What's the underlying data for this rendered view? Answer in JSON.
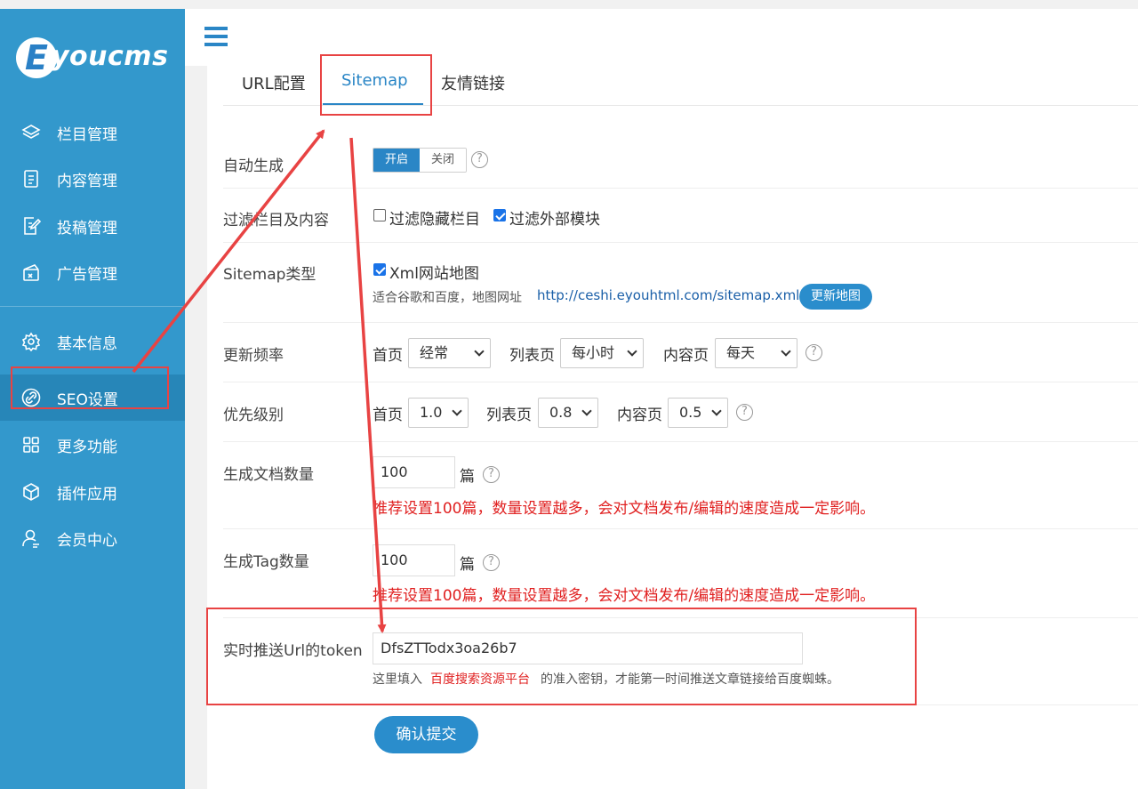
{
  "brand": {
    "logo_letter": "E",
    "logo_text": "youcms"
  },
  "sidebar": {
    "items": [
      {
        "label": "栏目管理",
        "icon": "layers-icon"
      },
      {
        "label": "内容管理",
        "icon": "document-icon"
      },
      {
        "label": "投稿管理",
        "icon": "edit-document-icon"
      },
      {
        "label": "广告管理",
        "icon": "ad-icon"
      },
      {
        "label": "基本信息",
        "icon": "gear-icon"
      },
      {
        "label": "SEO设置",
        "icon": "link-icon"
      },
      {
        "label": "更多功能",
        "icon": "grid-icon"
      },
      {
        "label": "插件应用",
        "icon": "cube-icon"
      },
      {
        "label": "会员中心",
        "icon": "user-icon"
      }
    ],
    "active_index": 5
  },
  "tabs": [
    {
      "label": "URL配置"
    },
    {
      "label": "Sitemap"
    },
    {
      "label": "友情链接"
    }
  ],
  "active_tab": 1,
  "form": {
    "auto_gen": {
      "label": "自动生成",
      "on": "开启",
      "off": "关闭"
    },
    "filter": {
      "label": "过滤栏目及内容",
      "opt1": "过滤隐藏栏目",
      "opt2": "过滤外部模块"
    },
    "sitemap_type": {
      "label": "Sitemap类型",
      "option": "Xml网站地图",
      "note": "适合谷歌和百度，地图网址",
      "url": "http://ceshi.eyouhtml.com/sitemap.xml",
      "update_btn": "更新地图"
    },
    "freq": {
      "label": "更新频率",
      "home_label": "首页",
      "home_value": "经常",
      "list_label": "列表页",
      "list_value": "每小时",
      "content_label": "内容页",
      "content_value": "每天"
    },
    "priority": {
      "label": "优先级别",
      "home_label": "首页",
      "home_value": "1.0",
      "list_label": "列表页",
      "list_value": "0.8",
      "content_label": "内容页",
      "content_value": "0.5"
    },
    "doc_count": {
      "label": "生成文档数量",
      "value": "100",
      "unit": "篇",
      "hint": "推荐设置100篇，数量设置越多，会对文档发布/编辑的速度造成一定影响。"
    },
    "tag_count": {
      "label": "生成Tag数量",
      "value": "100",
      "unit": "篇",
      "hint": "推荐设置100篇，数量设置越多，会对文档发布/编辑的速度造成一定影响。"
    },
    "token": {
      "label": "实时推送Url的token",
      "value": "DfsZTTodx3oa26b7",
      "note_pre": "这里填入",
      "note_link": "百度搜索资源平台",
      "note_post": "的准入密钥，才能第一时间推送文章链接给百度蜘蛛。"
    },
    "submit": "确认提交"
  },
  "colors": {
    "sidebar": "#3398cc",
    "accent": "#2a86c6",
    "annotation": "#e84343",
    "warning": "#e02020"
  }
}
